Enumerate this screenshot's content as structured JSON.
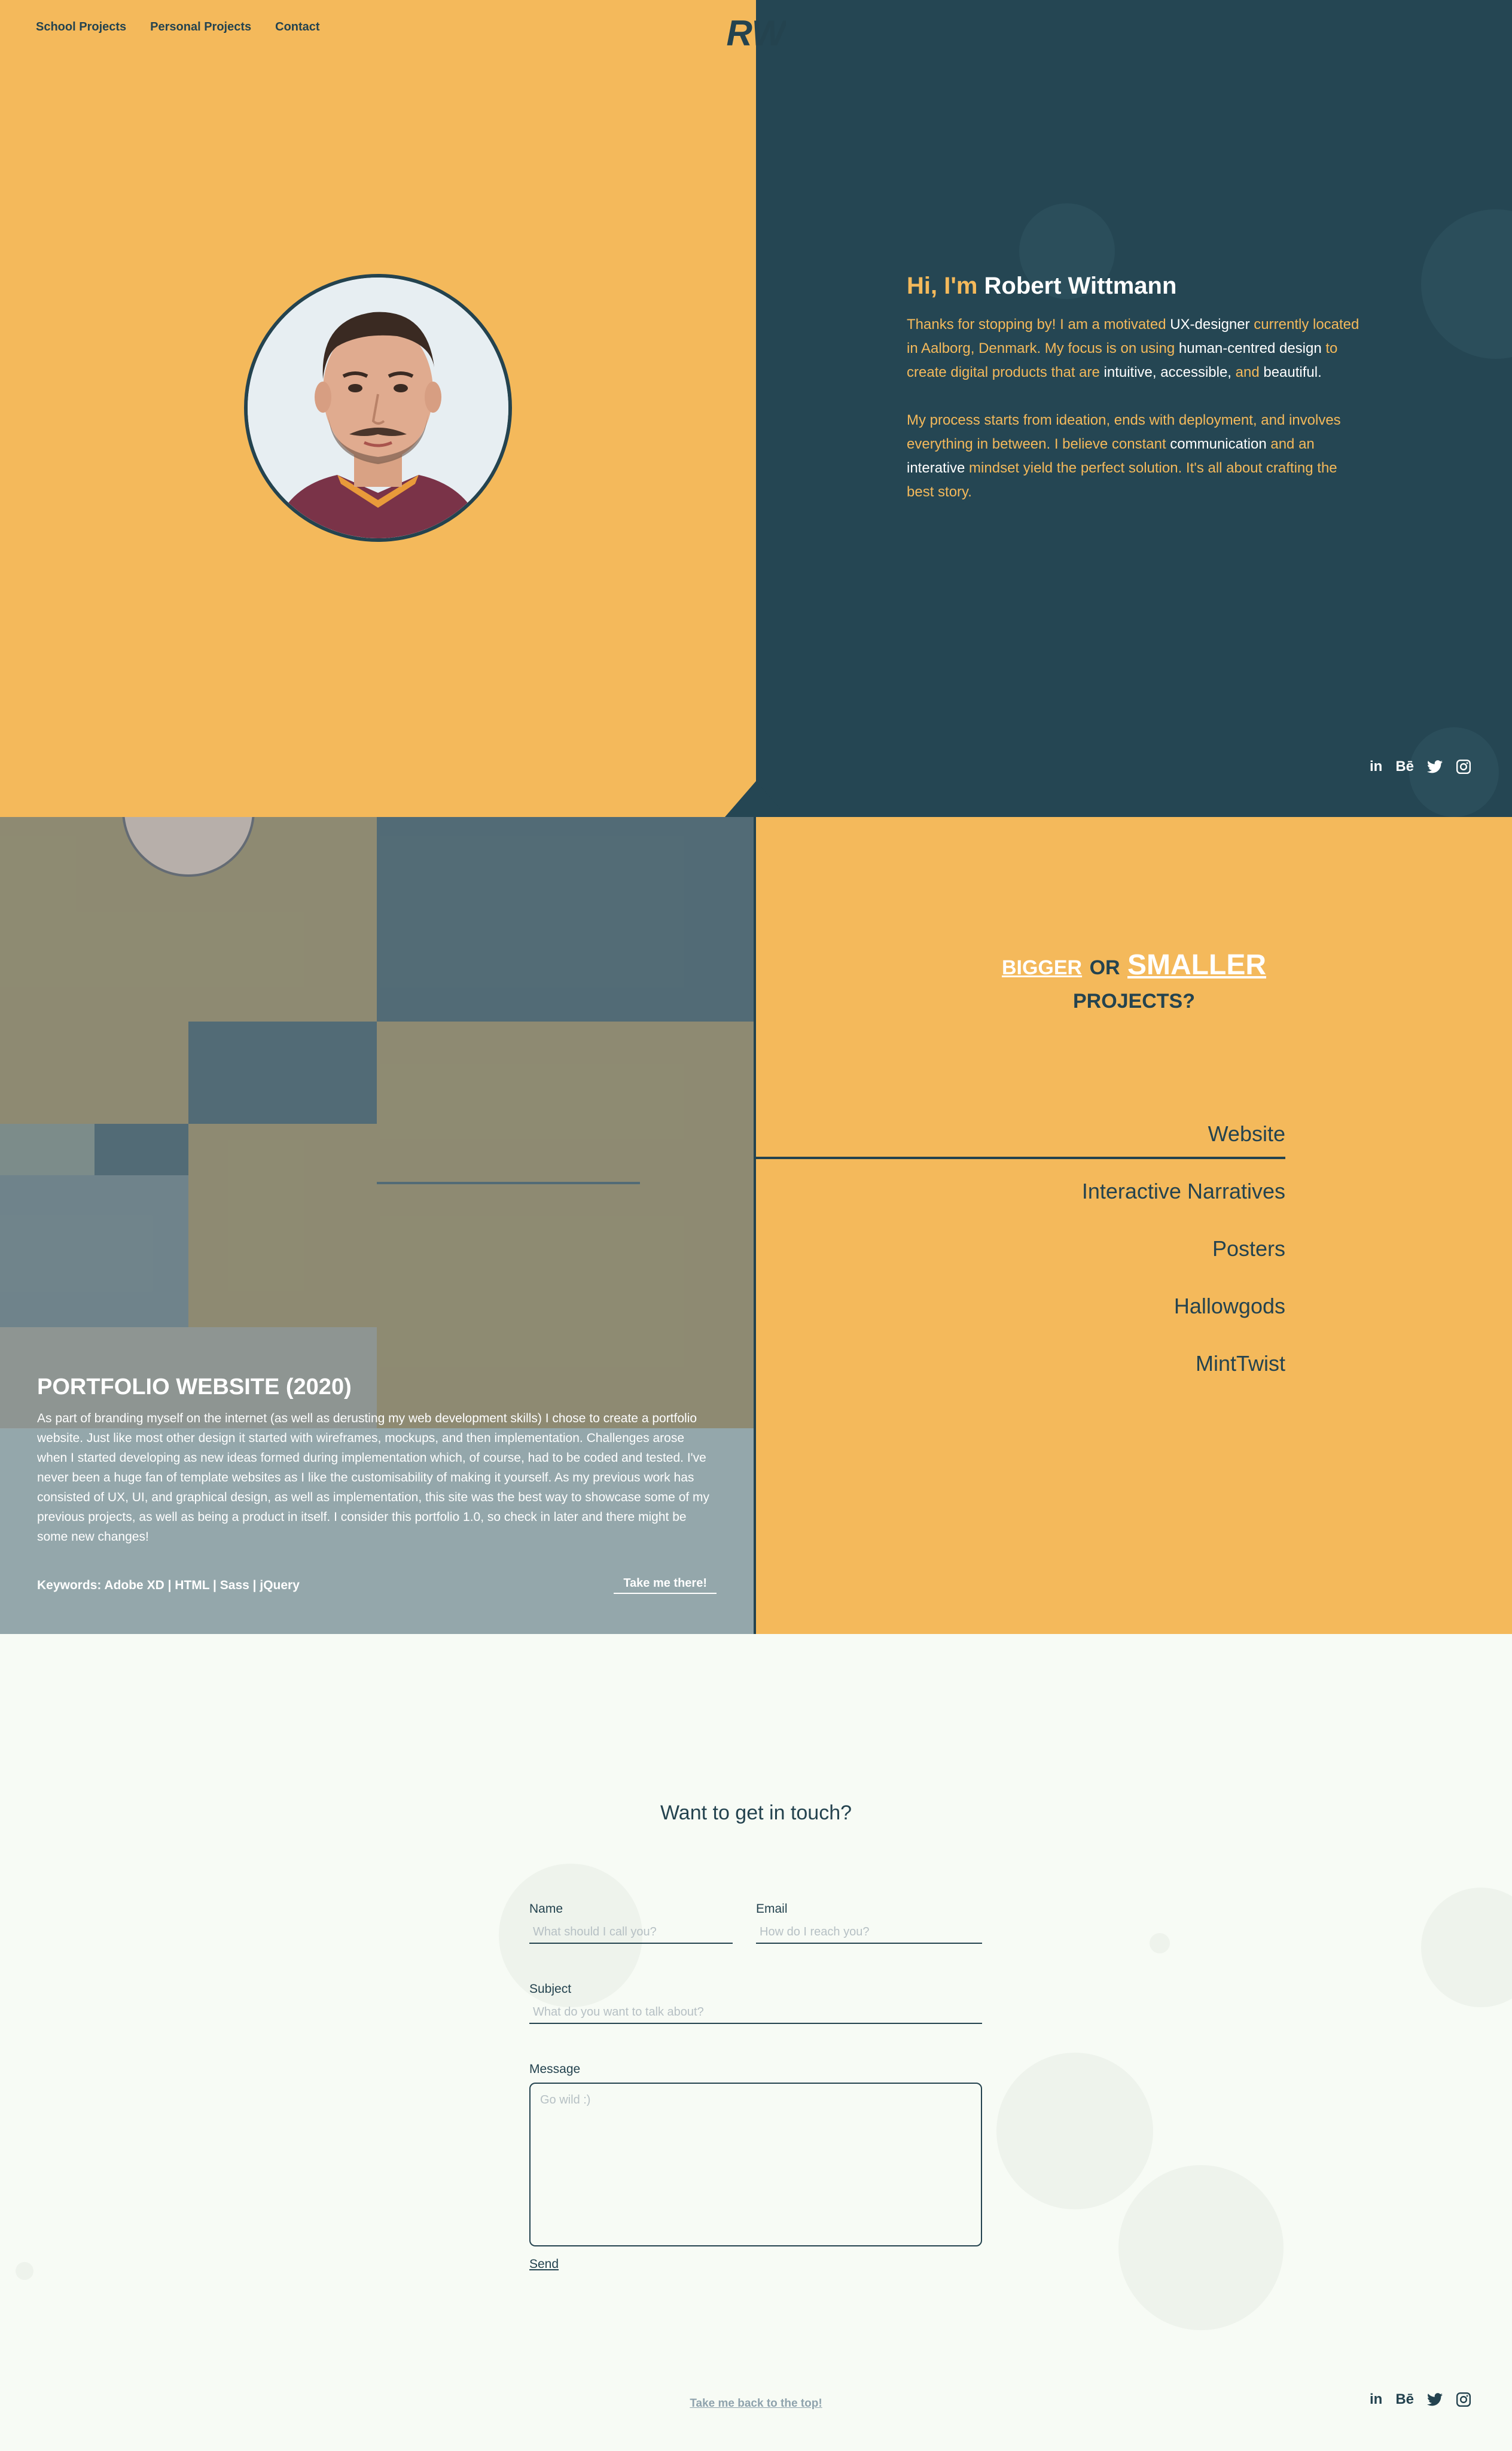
{
  "nav": {
    "items": [
      "School Projects",
      "Personal Projects",
      "Contact"
    ]
  },
  "logo": {
    "text": "RW"
  },
  "hero": {
    "greeting": "Hi, I'm",
    "name": "Robert Wittmann",
    "p1": [
      {
        "t": "Thanks for stopping by! I am a motivated ",
        "w": false
      },
      {
        "t": "UX-designer",
        "w": true
      },
      {
        "t": " currently located in Aalborg, Denmark. My focus is on using ",
        "w": false
      },
      {
        "t": "human-centred design",
        "w": true
      },
      {
        "t": " to create digital products that are ",
        "w": false
      },
      {
        "t": "intuitive, accessible,",
        "w": true
      },
      {
        "t": " and ",
        "w": false
      },
      {
        "t": "beautiful.",
        "w": true
      }
    ],
    "p2": [
      {
        "t": "My process starts from ideation, ends with deployment, and involves everything in between. I believe constant ",
        "w": false
      },
      {
        "t": "communication",
        "w": true
      },
      {
        "t": " and an ",
        "w": false
      },
      {
        "t": "interative",
        "w": true
      },
      {
        "t": " mindset yield the perfect solution. It's all about crafting the best story.",
        "w": false
      }
    ]
  },
  "social": {
    "linkedin": "in",
    "behance": "Bē"
  },
  "project_preview": {
    "title": "PORTFOLIO WEBSITE (2020)",
    "description": "As part of branding myself on the internet (as well as derusting my web development skills) I chose to create a portfolio website. Just like most other design it started with wireframes, mockups, and then implementation. Challenges arose when I started developing as new ideas formed during implementation which, of course, had to be coded and tested. I've never been a huge fan of template websites as I like the customisability of making it yourself. As my previous work has consisted of UX, UI, and graphical design, as well as implementation, this site was the best way to showcase some of my previous projects, as well as being a product in itself. I consider this portfolio 1.0, so check in later and there might be some new changes!",
    "keywords": "Keywords: Adobe XD | HTML | Sass | jQuery",
    "cta": "Take me there!"
  },
  "projects": {
    "bigger": "BIGGER",
    "or": "OR",
    "smaller": "SMALLER",
    "projects_word": "PROJECTS?",
    "items": [
      "Website",
      "Interactive Narratives",
      "Posters",
      "Hallowgods",
      "MintTwist"
    ],
    "active_index": 0
  },
  "contact": {
    "heading": "Want to get in touch?",
    "name_label": "Name",
    "name_placeholder": "What should I call you?",
    "email_label": "Email",
    "email_placeholder": "How do I reach you?",
    "subject_label": "Subject",
    "subject_placeholder": "What do you want to talk about?",
    "message_label": "Message",
    "message_placeholder": "Go wild :)",
    "send": "Send",
    "back_to_top": "Take me back to the top!"
  },
  "colors": {
    "mustard": "#f4b95b",
    "navy": "#254653",
    "offwhite": "#f7fbf5"
  }
}
